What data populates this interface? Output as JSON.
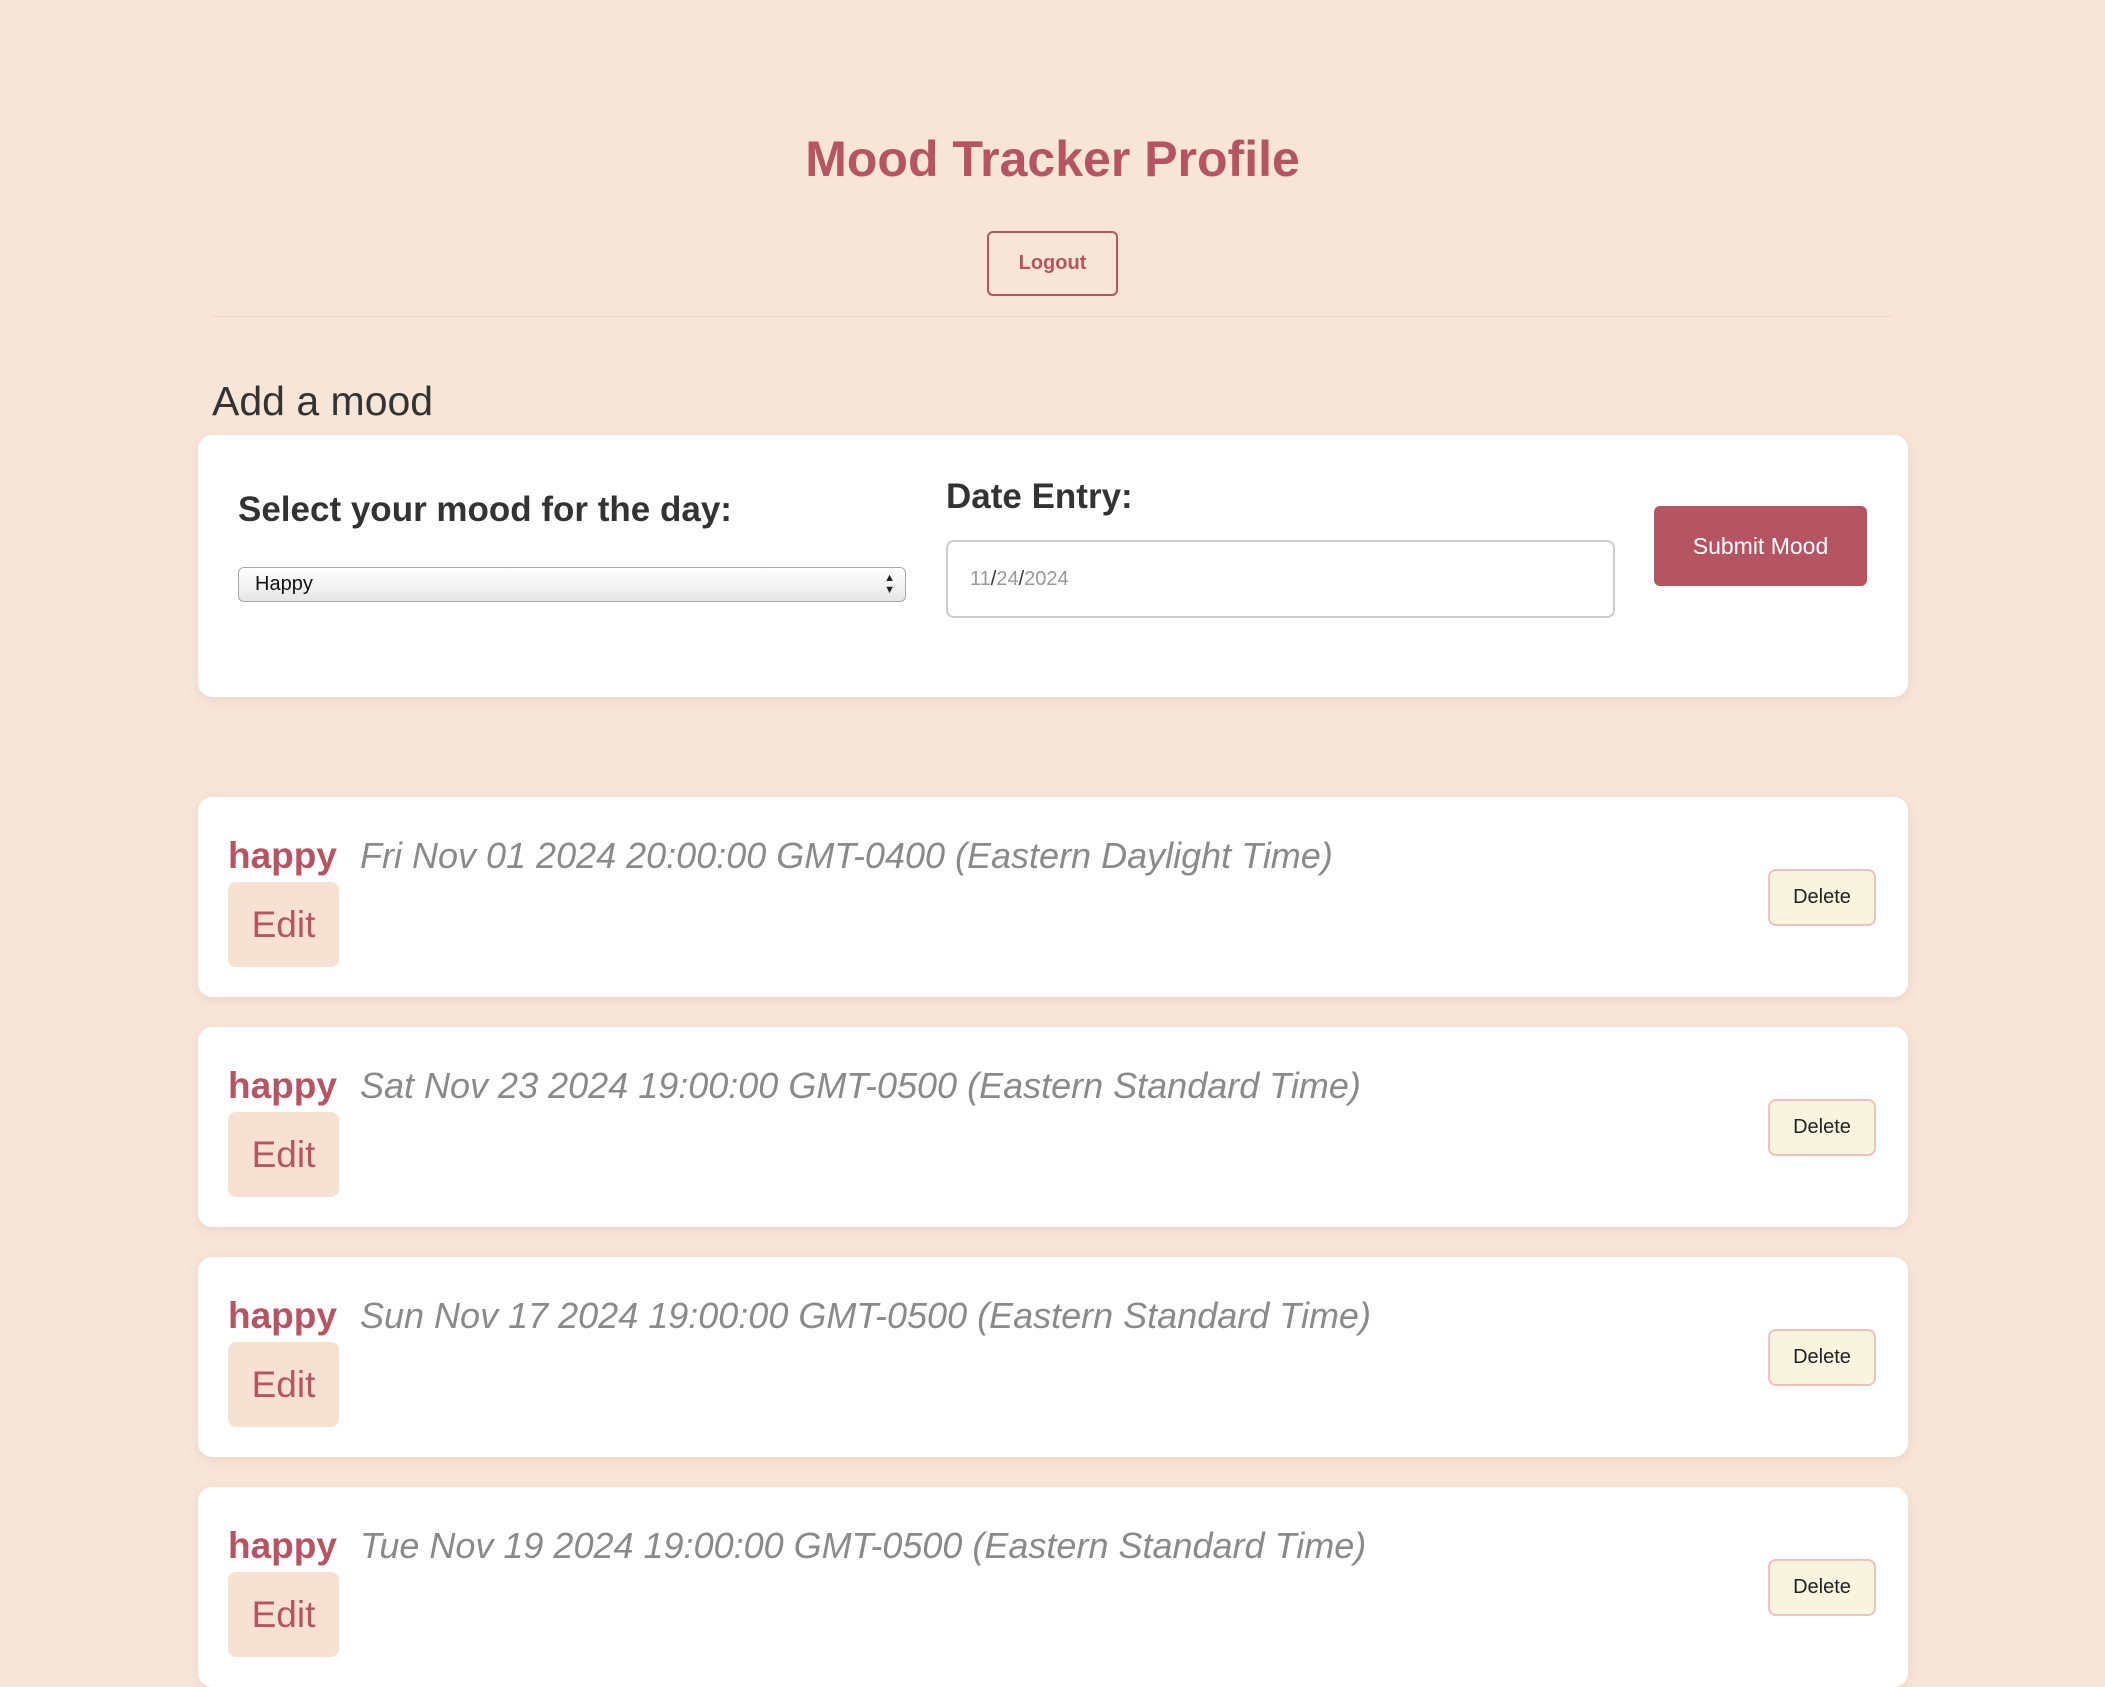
{
  "header": {
    "title": "Mood Tracker Profile",
    "logout_label": "Logout"
  },
  "form": {
    "heading": "Add a mood",
    "mood_label": "Select your mood for the day:",
    "mood_selected": "Happy",
    "date_label": "Date Entry:",
    "date_month": "11",
    "date_day": "24",
    "date_year": "2024",
    "date_separator": "/",
    "submit_label": "Submit Mood"
  },
  "entries": [
    {
      "mood": "happy",
      "date": "Fri Nov 01 2024 20:00:00 GMT-0400 (Eastern Daylight Time)",
      "edit_label": "Edit",
      "delete_label": "Delete"
    },
    {
      "mood": "happy",
      "date": "Sat Nov 23 2024 19:00:00 GMT-0500 (Eastern Standard Time)",
      "edit_label": "Edit",
      "delete_label": "Delete"
    },
    {
      "mood": "happy",
      "date": "Sun Nov 17 2024 19:00:00 GMT-0500 (Eastern Standard Time)",
      "edit_label": "Edit",
      "delete_label": "Delete"
    },
    {
      "mood": "happy",
      "date": "Tue Nov 19 2024 19:00:00 GMT-0500 (Eastern Standard Time)",
      "edit_label": "Edit",
      "delete_label": "Delete"
    }
  ],
  "colors": {
    "background": "#f7e5d7",
    "accent": "#b55463",
    "card": "#ffffff",
    "edit_button_bg": "#f7e1d3",
    "delete_button_bg": "#f9f4e0"
  },
  "icons": {
    "select_arrows": "updown-arrows-icon"
  }
}
